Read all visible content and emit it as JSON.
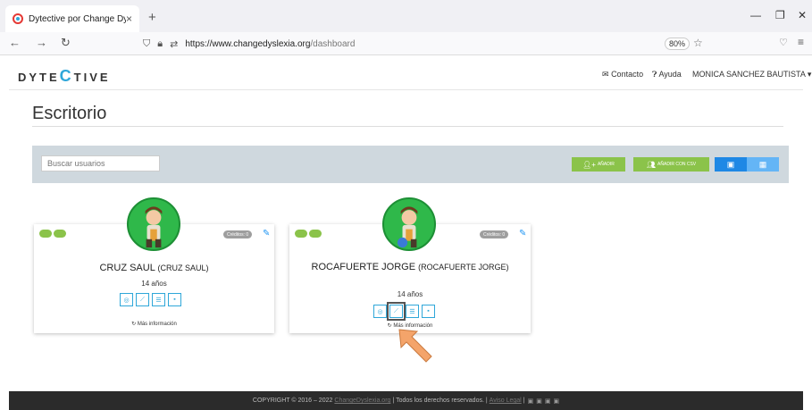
{
  "browser": {
    "tab_title": "Dytective por Change Dyslexia",
    "tab_close": "×",
    "new_tab": "+",
    "url_host": "https://www.changedyslexia.org",
    "url_path": "/dashboard",
    "zoom": "80%"
  },
  "header": {
    "logo_pre": "DYTE",
    "logo_c": "C",
    "logo_post": "TIVE",
    "contact": "Contacto",
    "help": "Ayuda",
    "user": "MONICA SANCHEZ BAUTISTA ▾"
  },
  "main": {
    "title": "Escritorio",
    "search_placeholder": "Buscar usuarios",
    "add_label": "Añadir",
    "add_csv_label": "Añadir con CSV"
  },
  "cards": [
    {
      "name": "CRUZ SAUL",
      "full": "(CRUZ SAUL)",
      "age": "14 años",
      "credits": "Créditos: 0",
      "more": "Más información"
    },
    {
      "name": "ROCAFUERTE JORGE",
      "full": "(ROCAFUERTE JORGE)",
      "age": "14 años",
      "credits": "Créditos: 0",
      "more": "Más información"
    }
  ],
  "footer": {
    "copyright": "COPYRIGHT © 2016 – 2022",
    "site_link": "ChangeDyslexia.org",
    "rights": "| Todos los derechos reservados. |",
    "legal_link": "Aviso Legal",
    "sep": "|"
  },
  "colors": {
    "green": "#8bc34a",
    "blue_active": "#1e88e5",
    "blue_light": "#64b5f6",
    "accent": "#2fa7d9",
    "arrow": "#f4a46a",
    "footer_bg": "#2b2b2b"
  }
}
